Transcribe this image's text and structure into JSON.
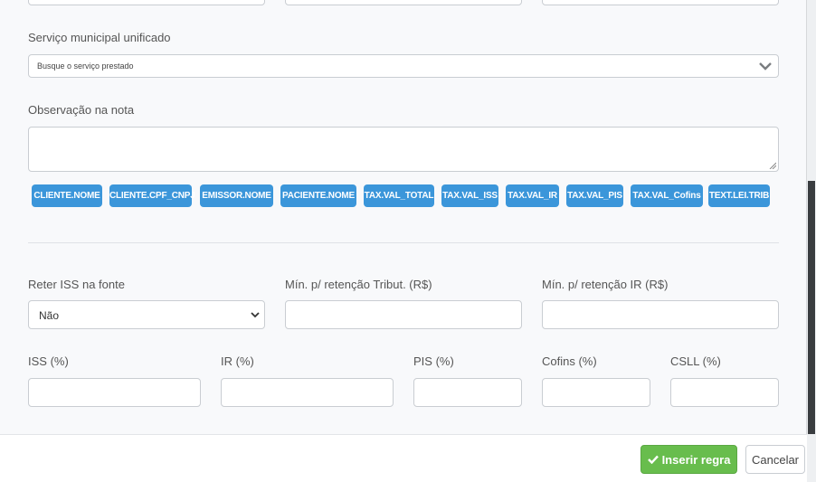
{
  "service": {
    "label": "Serviço municipal unificado",
    "placeholder": "Busque o serviço prestado"
  },
  "observation": {
    "label": "Observação na nota",
    "value": ""
  },
  "tags": [
    "CLIENTE.NOME",
    "CLIENTE.CPF_CNPJ",
    "EMISSOR.NOME",
    "PACIENTE.NOME",
    "TAX.VAL_TOTAL",
    "TAX.VAL_ISS",
    "TAX.VAL_IR",
    "TAX.VAL_PIS",
    "TAX.VAL_Cofins",
    "TEXT.LEI.TRIB"
  ],
  "retention": {
    "iss_label": "Reter ISS na fonte",
    "iss_value": "Não",
    "min_tribut_label": "Mín. p/ retenção Tribut. (R$)",
    "min_tribut_value": "",
    "min_ir_label": "Mín. p/ retenção IR (R$)",
    "min_ir_value": ""
  },
  "taxes": {
    "iss_label": "ISS (%)",
    "ir_label": "IR (%)",
    "pis_label": "PIS (%)",
    "cofins_label": "Cofins (%)",
    "csll_label": "CSLL (%)"
  },
  "footer": {
    "insert_label": "Inserir regra",
    "cancel_label": "Cancelar"
  },
  "colors": {
    "tag_bg": "#3b96da",
    "insert_bg": "#68bd4d"
  }
}
